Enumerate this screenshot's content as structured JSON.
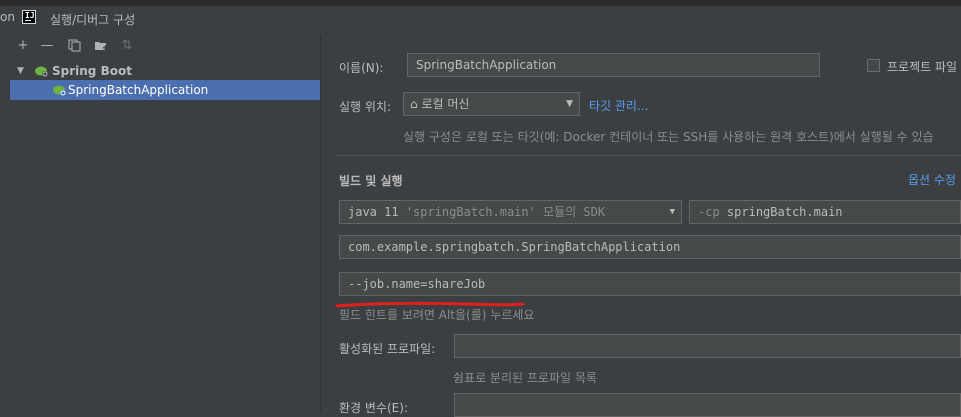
{
  "window": {
    "title": "실행/디버그 구성",
    "background_left_text": "on"
  },
  "toolbar": {
    "icons": [
      "add-icon",
      "remove-icon",
      "copy-icon",
      "folder-add-icon",
      "sort-icon"
    ]
  },
  "tree": {
    "group_label": "Spring Boot",
    "item_label": "SpringBatchApplication"
  },
  "form": {
    "name_label": "이름(N):",
    "name_value": "SpringBatchApplication",
    "project_file_label": "프로젝트 파일",
    "run_on_label": "실행 위치:",
    "run_on_value": "로컬 머신",
    "manage_targets_link": "타깃 관리...",
    "run_on_hint": "실행 구성은 로컬 또는 타깃(예: Docker 컨테이너 또는 SSH를 사용하는 원격 호스트)에서 실행될 수 있습",
    "build_section_label": "빌드 및 실행",
    "modify_options_link": "옵션 수정",
    "jdk_prefix": "java 11",
    "jdk_detail": "'springBatch.main' 모듈의 SDK",
    "cp_prefix": "-cp",
    "cp_value": "springBatch.main",
    "main_class_value": "com.example.springbatch.SpringBatchApplication",
    "program_args_value": "--job.name=shareJob",
    "field_hint": "필드 힌트를 보려면 Alt을(를) 누르세요",
    "active_profiles_label": "활성화된 프로파일:",
    "active_profiles_value": "",
    "profiles_hint": "쉼표로 분리된 프로파일 목록",
    "env_vars_label": "환경 변수(E):"
  },
  "colors": {
    "background": "#3c3f41",
    "selection": "#4b6eaf",
    "link": "#589df6",
    "annotation_underline": "#e0201b"
  }
}
